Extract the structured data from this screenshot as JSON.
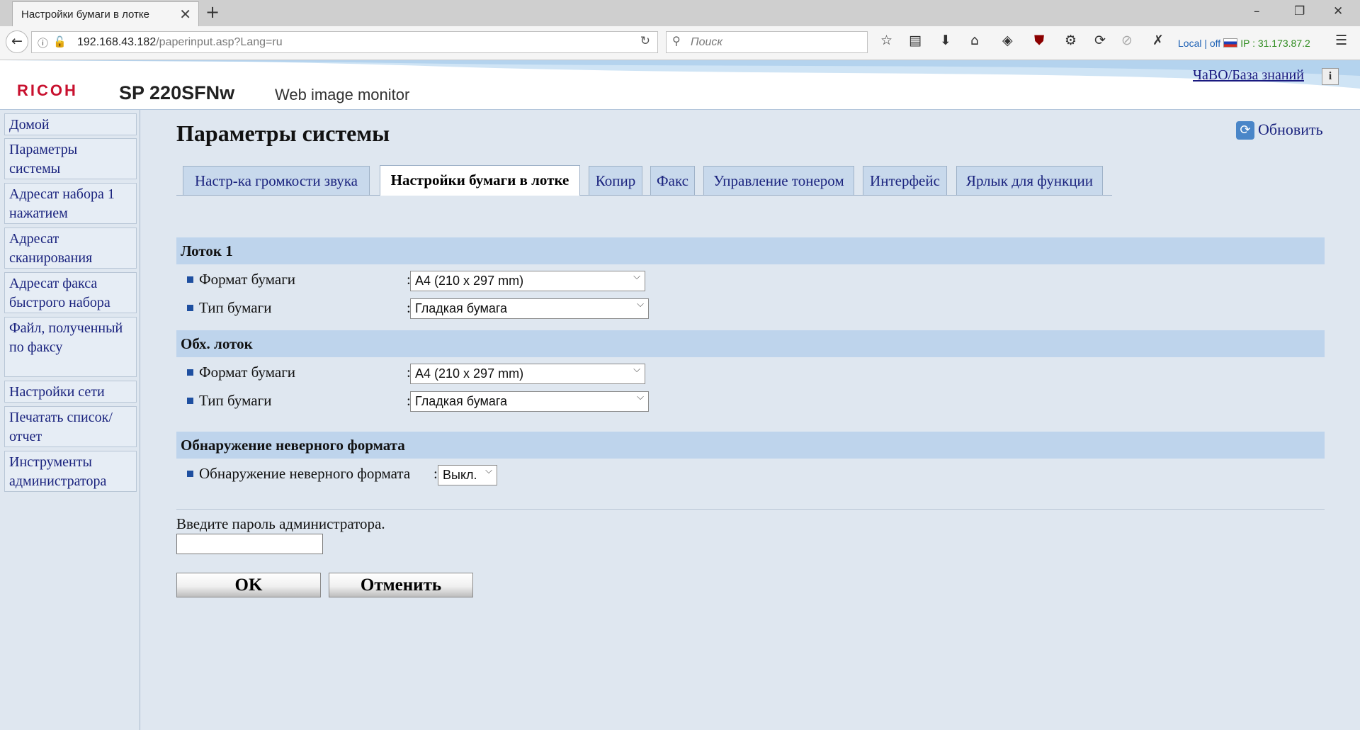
{
  "browser": {
    "tab_title": "Настройки бумаги в лотке",
    "url_host": "192.168.43.182",
    "url_path": "/paperinput.asp?Lang=ru",
    "search_placeholder": "Поиск",
    "ext_local": "Local | off",
    "ext_ip": "IP : 31.173.87.2"
  },
  "header": {
    "brand": "RICOH",
    "model": "SP 220SFNw",
    "app_name": "Web image monitor",
    "faq_link": "ЧаВО/База знаний",
    "info_glyph": "i"
  },
  "sidebar": {
    "items": [
      {
        "label": "Домой"
      },
      {
        "label": "Параметры системы"
      },
      {
        "label": "Адресат набора 1 нажатием"
      },
      {
        "label": "Адресат сканирования"
      },
      {
        "label": "Адресат факса быстрого набора"
      },
      {
        "label": "Файл, полученный по факсу"
      },
      {
        "label": "Настройки сети"
      },
      {
        "label": "Печатать список/отчет"
      },
      {
        "label": "Инструменты администратора"
      }
    ]
  },
  "main": {
    "title": "Параметры системы",
    "refresh_label": "Обновить",
    "tabs": [
      {
        "label": "Настр-ка громкости звука",
        "active": false
      },
      {
        "label": "Настройки бумаги в лотке",
        "active": true
      },
      {
        "label": "Копир",
        "active": false
      },
      {
        "label": "Факс",
        "active": false
      },
      {
        "label": "Управление тонером",
        "active": false
      },
      {
        "label": "Интерфейс",
        "active": false
      },
      {
        "label": "Ярлык для функции",
        "active": false
      }
    ],
    "sections": [
      {
        "title": "Лоток 1",
        "rows": [
          {
            "label": "Формат бумаги",
            "value": "A4 (210 x 297 mm)"
          },
          {
            "label": "Тип бумаги",
            "value": "Гладкая бумага"
          }
        ]
      },
      {
        "title": "Обх. лоток",
        "rows": [
          {
            "label": "Формат бумаги",
            "value": "A4 (210 x 297 mm)"
          },
          {
            "label": "Тип бумаги",
            "value": "Гладкая бумага"
          }
        ]
      },
      {
        "title": "Обнаружение неверного формата",
        "rows": [
          {
            "label": "Обнаружение неверного формата",
            "value": "Выкл."
          }
        ]
      }
    ],
    "password_label": "Введите пароль администратора.",
    "password_value": "",
    "ok_label": "OK",
    "cancel_label": "Отменить"
  }
}
